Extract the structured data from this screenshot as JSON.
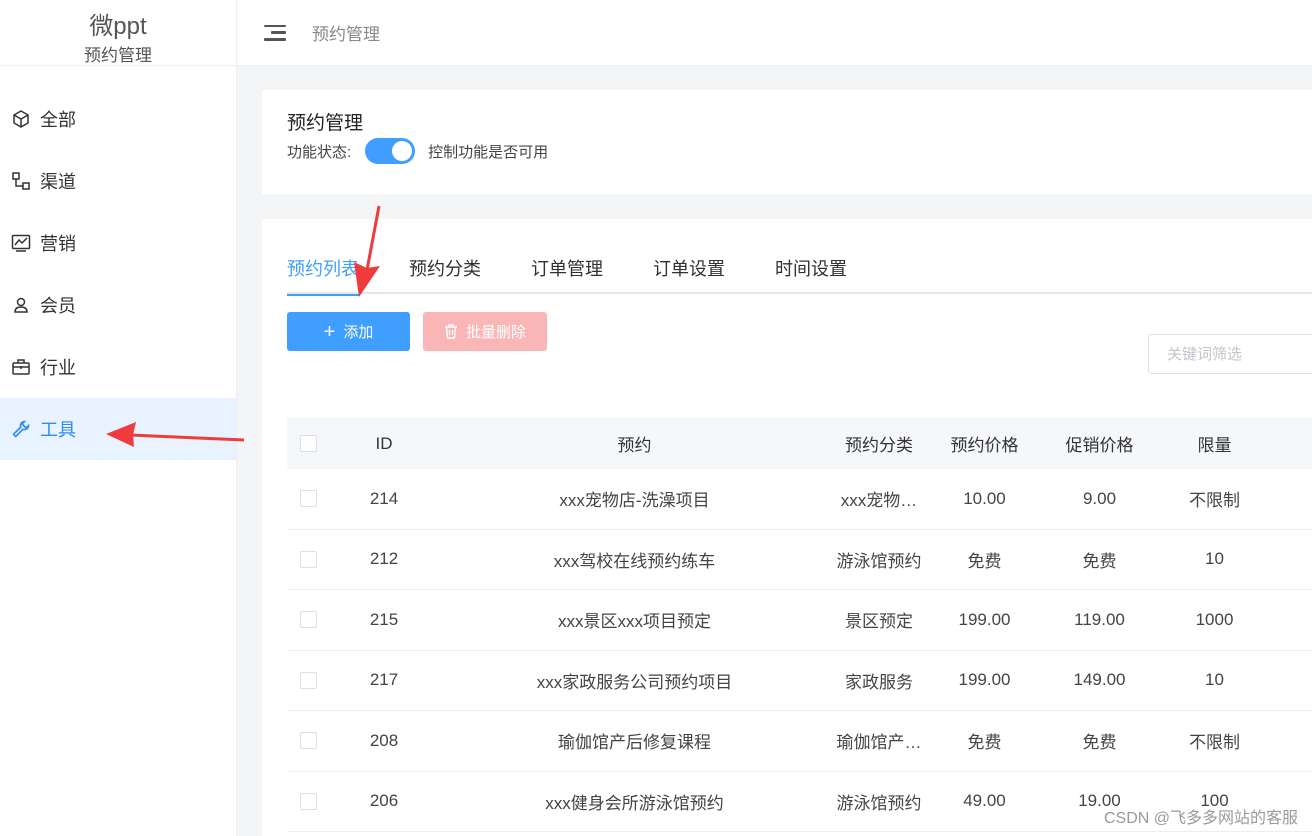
{
  "sidebar": {
    "brand": "微ppt",
    "subtitle": "预约管理",
    "items": [
      {
        "label": "全部",
        "icon": "cube-icon"
      },
      {
        "label": "渠道",
        "icon": "channel-icon"
      },
      {
        "label": "营销",
        "icon": "chart-line-icon"
      },
      {
        "label": "会员",
        "icon": "user-icon"
      },
      {
        "label": "行业",
        "icon": "briefcase-icon"
      },
      {
        "label": "工具",
        "icon": "wrench-icon",
        "active": true
      }
    ]
  },
  "header": {
    "title": "预约管理"
  },
  "card": {
    "title": "预约管理",
    "status_label": "功能状态:",
    "switch_on": true,
    "status_hint": "控制功能是否可用"
  },
  "tabs": [
    {
      "label": "预约列表",
      "active": true
    },
    {
      "label": "预约分类"
    },
    {
      "label": "订单管理"
    },
    {
      "label": "订单设置"
    },
    {
      "label": "时间设置"
    }
  ],
  "toolbar": {
    "add_label": "添加",
    "batch_delete_label": "批量删除",
    "search_placeholder": "关键词筛选"
  },
  "table": {
    "headers": {
      "id": "ID",
      "name": "预约",
      "category": "预约分类",
      "price": "预约价格",
      "promo": "促销价格",
      "limit": "限量"
    },
    "rows": [
      {
        "id": "214",
        "name": "xxx宠物店-洗澡项目",
        "category": "xxx宠物…",
        "price": "10.00",
        "promo": "9.00",
        "limit": "不限制"
      },
      {
        "id": "212",
        "name": "xxx驾校在线预约练车",
        "category": "游泳馆预约",
        "price": "免费",
        "promo": "免费",
        "limit": "10"
      },
      {
        "id": "215",
        "name": "xxx景区xxx项目预定",
        "category": "景区预定",
        "price": "199.00",
        "promo": "119.00",
        "limit": "1000"
      },
      {
        "id": "217",
        "name": "xxx家政服务公司预约项目",
        "category": "家政服务",
        "price": "199.00",
        "promo": "149.00",
        "limit": "10"
      },
      {
        "id": "208",
        "name": "瑜伽馆产后修复课程",
        "category": "瑜伽馆产…",
        "price": "免费",
        "promo": "免费",
        "limit": "不限制"
      },
      {
        "id": "206",
        "name": "xxx健身会所游泳馆预约",
        "category": "游泳馆预约",
        "price": "49.00",
        "promo": "19.00",
        "limit": "100"
      }
    ]
  },
  "watermark": "CSDN @飞多多网站的客服",
  "colors": {
    "primary": "#409eff",
    "danger_disabled": "#fab6b6",
    "annotation_arrow": "#ee3b3b"
  }
}
